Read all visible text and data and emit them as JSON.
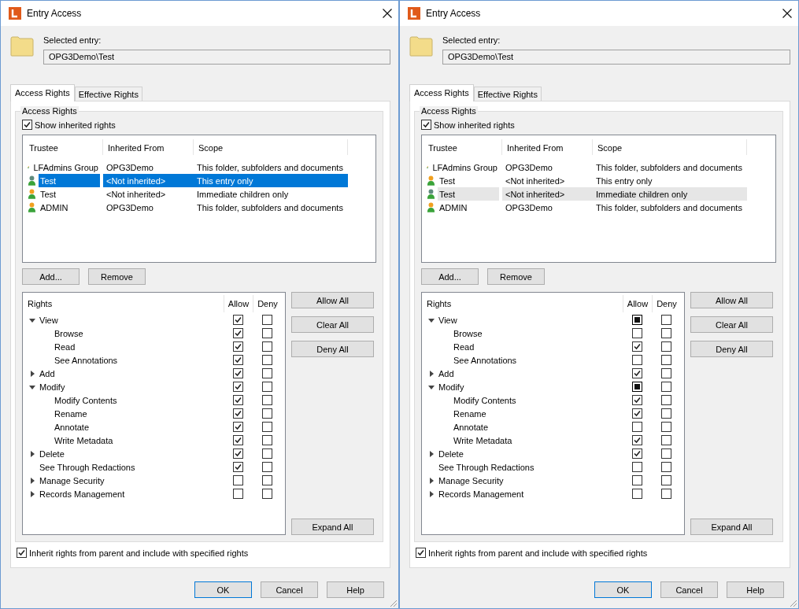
{
  "dialogs": [
    {
      "title": "Entry Access",
      "selected_entry_label": "Selected entry:",
      "selected_entry": "OPG3Demo\\Test",
      "tabs": [
        {
          "label": "Access Rights",
          "selected": true
        },
        {
          "label": "Effective Rights",
          "selected": false
        }
      ],
      "group_title": "Access Rights",
      "show_inherited": {
        "label": "Show inherited rights",
        "checked": true
      },
      "list_focused": true,
      "trustee_columns": [
        "Trustee",
        "Inherited From",
        "Scope"
      ],
      "trustees": [
        {
          "kind": "group",
          "name": "LFAdmins Group",
          "inherited_from": "OPG3Demo",
          "scope": "This folder, subfolders and documents",
          "selected": false
        },
        {
          "kind": "user",
          "name": "Test",
          "inherited_from": "<Not inherited>",
          "scope": "This entry only",
          "selected": true
        },
        {
          "kind": "user",
          "name": "Test",
          "inherited_from": "<Not inherited>",
          "scope": "Immediate children only",
          "selected": false
        },
        {
          "kind": "user",
          "name": "ADMIN",
          "inherited_from": "OPG3Demo",
          "scope": "This folder, subfolders and documents",
          "selected": false
        }
      ],
      "list_buttons": [
        "Add...",
        "Remove"
      ],
      "rights_columns": [
        "Rights",
        "Allow",
        "Deny"
      ],
      "rights": [
        {
          "name": "View",
          "expanded": true,
          "allow": {
            "kind": "tick"
          },
          "deny_checked": false,
          "children": [
            {
              "name": "Browse",
              "allow": {
                "kind": "tick"
              },
              "deny_checked": false
            },
            {
              "name": "Read",
              "allow": {
                "kind": "tick"
              },
              "deny_checked": false
            },
            {
              "name": "See Annotations",
              "allow": {
                "kind": "tick"
              },
              "deny_checked": false
            }
          ]
        },
        {
          "name": "Add",
          "expanded": false,
          "allow": {
            "kind": "tick"
          },
          "deny_checked": false
        },
        {
          "name": "Modify",
          "expanded": true,
          "allow": {
            "kind": "tick"
          },
          "deny_checked": false,
          "children": [
            {
              "name": "Modify Contents",
              "allow": {
                "kind": "tick"
              },
              "deny_checked": false
            },
            {
              "name": "Rename",
              "allow": {
                "kind": "tick"
              },
              "deny_checked": false
            },
            {
              "name": "Annotate",
              "allow": {
                "kind": "tick"
              },
              "deny_checked": false
            },
            {
              "name": "Write Metadata",
              "allow": {
                "kind": "tick"
              },
              "deny_checked": false
            }
          ]
        },
        {
          "name": "Delete",
          "expanded": false,
          "allow": {
            "kind": "tick"
          },
          "deny_checked": false
        },
        {
          "name": "See Through Redactions",
          "allow": {
            "kind": "tick"
          },
          "deny_checked": false
        },
        {
          "name": "Manage Security",
          "expanded": false,
          "allow": {
            "kind": "blank"
          },
          "deny_checked": false
        },
        {
          "name": "Records Management",
          "expanded": false,
          "allow": {
            "kind": "blank"
          },
          "deny_checked": false
        }
      ],
      "side_buttons": [
        "Allow All",
        "Clear All",
        "Deny All"
      ],
      "expand_button": "Expand All",
      "inherit": {
        "label": "Inherit rights from parent and include with specified rights",
        "checked": true
      },
      "footer_buttons": [
        "OK",
        "Cancel",
        "Help"
      ]
    },
    {
      "title": "Entry Access",
      "selected_entry_label": "Selected entry:",
      "selected_entry": "OPG3Demo\\Test",
      "tabs": [
        {
          "label": "Access Rights",
          "selected": true
        },
        {
          "label": "Effective Rights",
          "selected": false
        }
      ],
      "group_title": "Access Rights",
      "show_inherited": {
        "label": "Show inherited rights",
        "checked": true
      },
      "list_focused": false,
      "trustee_columns": [
        "Trustee",
        "Inherited From",
        "Scope"
      ],
      "trustees": [
        {
          "kind": "group",
          "name": "LFAdmins Group",
          "inherited_from": "OPG3Demo",
          "scope": "This folder, subfolders and documents",
          "selected": false
        },
        {
          "kind": "user",
          "name": "Test",
          "inherited_from": "<Not inherited>",
          "scope": "This entry only",
          "selected": false
        },
        {
          "kind": "user",
          "name": "Test",
          "inherited_from": "<Not inherited>",
          "scope": "Immediate children only",
          "selected": true
        },
        {
          "kind": "user",
          "name": "ADMIN",
          "inherited_from": "OPG3Demo",
          "scope": "This folder, subfolders and documents",
          "selected": false
        }
      ],
      "list_buttons": [
        "Add...",
        "Remove"
      ],
      "rights_columns": [
        "Rights",
        "Allow",
        "Deny"
      ],
      "rights": [
        {
          "name": "View",
          "expanded": true,
          "allow": {
            "kind": "square"
          },
          "deny_checked": false,
          "children": [
            {
              "name": "Browse",
              "allow": {
                "kind": "blank"
              },
              "deny_checked": false
            },
            {
              "name": "Read",
              "allow": {
                "kind": "tick"
              },
              "deny_checked": false
            },
            {
              "name": "See Annotations",
              "allow": {
                "kind": "blank"
              },
              "deny_checked": false
            }
          ]
        },
        {
          "name": "Add",
          "expanded": false,
          "allow": {
            "kind": "tick"
          },
          "deny_checked": false
        },
        {
          "name": "Modify",
          "expanded": true,
          "allow": {
            "kind": "square"
          },
          "deny_checked": false,
          "children": [
            {
              "name": "Modify Contents",
              "allow": {
                "kind": "tick"
              },
              "deny_checked": false
            },
            {
              "name": "Rename",
              "allow": {
                "kind": "tick"
              },
              "deny_checked": false
            },
            {
              "name": "Annotate",
              "allow": {
                "kind": "blank"
              },
              "deny_checked": false
            },
            {
              "name": "Write Metadata",
              "allow": {
                "kind": "tick"
              },
              "deny_checked": false
            }
          ]
        },
        {
          "name": "Delete",
          "expanded": false,
          "allow": {
            "kind": "tick"
          },
          "deny_checked": false
        },
        {
          "name": "See Through Redactions",
          "allow": {
            "kind": "blank"
          },
          "deny_checked": false
        },
        {
          "name": "Manage Security",
          "expanded": false,
          "allow": {
            "kind": "blank"
          },
          "deny_checked": false
        },
        {
          "name": "Records Management",
          "expanded": false,
          "allow": {
            "kind": "blank"
          },
          "deny_checked": false
        }
      ],
      "side_buttons": [
        "Allow All",
        "Clear All",
        "Deny All"
      ],
      "expand_button": "Expand All",
      "inherit": {
        "label": "Inherit rights from parent and include with specified rights",
        "checked": true
      },
      "footer_buttons": [
        "OK",
        "Cancel",
        "Help"
      ]
    }
  ]
}
